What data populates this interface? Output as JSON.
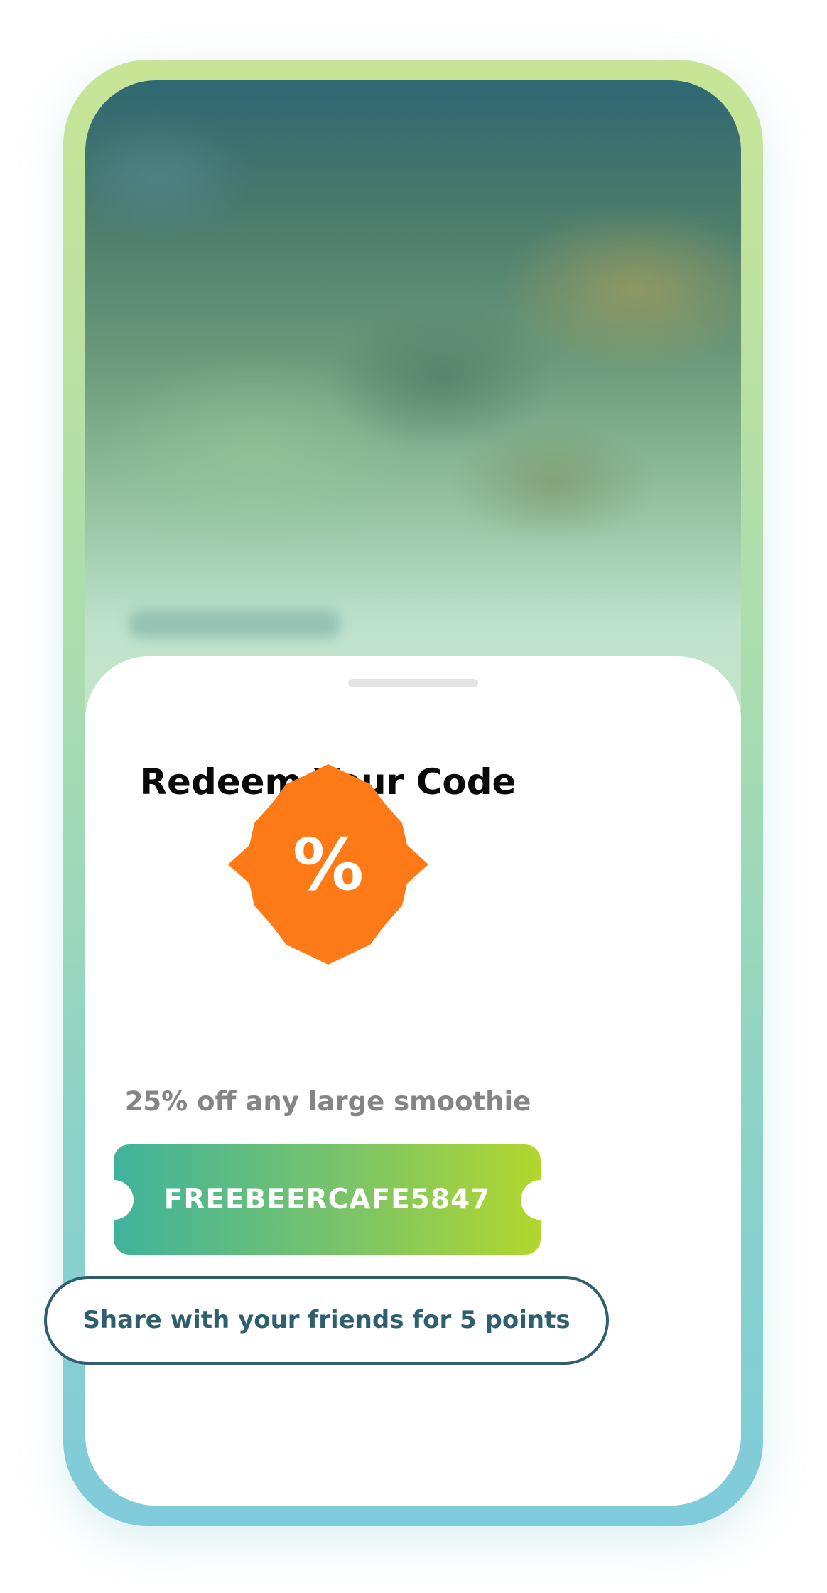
{
  "sheet": {
    "title": "Redeem Your Code",
    "badge_icon": "percent-badge-icon",
    "badge_symbol": "%",
    "badge_color": "#fd7a17",
    "offer_description": "25% off any large smoothie",
    "promo_code": "FREEBEERCAFE5847",
    "share_button_label": "Share with your friends for 5 points"
  },
  "colors": {
    "frame_gradient": [
      "#c8e596",
      "#7fcbdb"
    ],
    "ticket_gradient": [
      "#3fb39d",
      "#b2d72d"
    ],
    "share_border": "#2f5f6e",
    "title_text": "#0a0a0a",
    "offer_text": "#858585"
  }
}
